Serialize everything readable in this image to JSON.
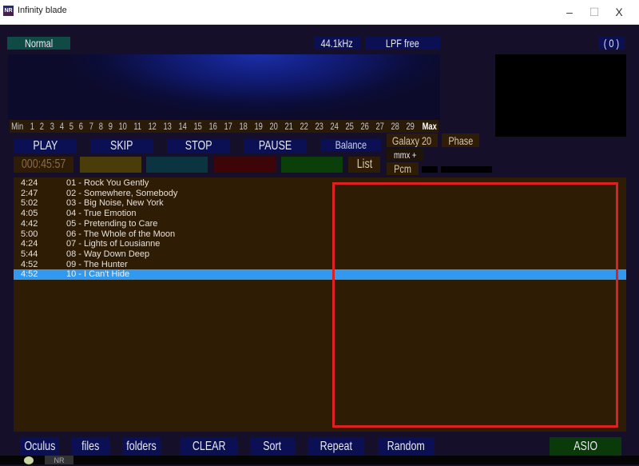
{
  "window": {
    "title": "Infinity blade",
    "app_icon": "NR",
    "controls": {
      "minimize": "–",
      "maximize": "☐",
      "close": "X"
    }
  },
  "status": {
    "mode": "Normal",
    "sample_rate": "44.1kHz",
    "filter": "LPF free",
    "counter": "( 0 )"
  },
  "scale": [
    "Min",
    "1",
    "2",
    "3",
    "4",
    "5",
    "6",
    "7",
    "8",
    "9",
    "10",
    "11",
    "12",
    "13",
    "14",
    "15",
    "16",
    "17",
    "18",
    "19",
    "20",
    "21",
    "22",
    "23",
    "24",
    "25",
    "26",
    "27",
    "28",
    "29",
    "Max"
  ],
  "transport": {
    "play": "PLAY",
    "skip": "SKIP",
    "stop": "STOP",
    "pause": "PAUSE",
    "balance": "Balance"
  },
  "options": {
    "galaxy": "Galaxy 20",
    "phase": "Phase",
    "mmx": "mmx +",
    "pcm": "Pcm",
    "list": "List"
  },
  "time": "000:45:57",
  "color_swatches": [
    "#4a3d0a",
    "#0a3540",
    "#3e0508",
    "#0a3f0a"
  ],
  "playlist": [
    {
      "time": "4:24",
      "title": "01 - Rock You Gently"
    },
    {
      "time": "2:47",
      "title": "02 - Somewhere, Somebody"
    },
    {
      "time": "5:02",
      "title": "03 - Big Noise, New York"
    },
    {
      "time": "4:05",
      "title": "04 - True Emotion"
    },
    {
      "time": "4:42",
      "title": "05 - Pretending to Care"
    },
    {
      "time": "5:00",
      "title": "06 - The Whole of the Moon"
    },
    {
      "time": "4:24",
      "title": "07 - Lights of Lousianne"
    },
    {
      "time": "5:44",
      "title": "08 - Way Down Deep"
    },
    {
      "time": "4:52",
      "title": "09 - The Hunter"
    },
    {
      "time": "4:52",
      "title": "10 - I Can't Hide",
      "selected": true
    }
  ],
  "bottom": {
    "oculus": "Oculus",
    "files": "files",
    "folders": "folders",
    "clear": "CLEAR",
    "sort": "Sort",
    "repeat": "Repeat",
    "random": "Random",
    "asio": "ASIO"
  },
  "taskbar": {
    "app": "NR"
  },
  "colors": {
    "selection": "#3399ee",
    "highlight_box": "#e02020",
    "background": "#150f2a",
    "playlist_bg": "#2e1c05"
  }
}
